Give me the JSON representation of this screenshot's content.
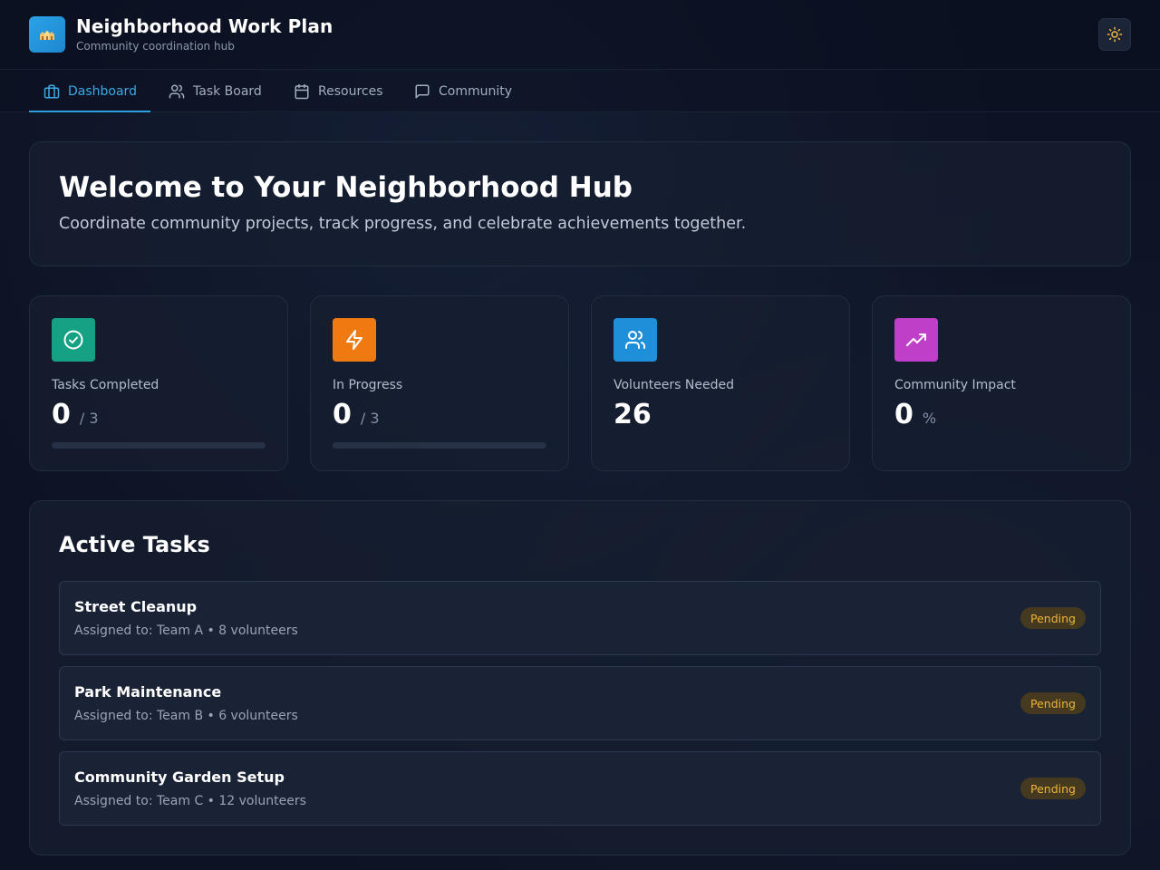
{
  "header": {
    "title": "Neighborhood Work Plan",
    "subtitle": "Community coordination hub",
    "logo_icon": "houses-icon",
    "theme_toggle_icon": "sun-icon"
  },
  "nav": {
    "tabs": [
      {
        "label": "Dashboard",
        "icon": "briefcase-icon",
        "active": true
      },
      {
        "label": "Task Board",
        "icon": "users-icon",
        "active": false
      },
      {
        "label": "Resources",
        "icon": "calendar-icon",
        "active": false
      },
      {
        "label": "Community",
        "icon": "chat-icon",
        "active": false
      }
    ]
  },
  "welcome": {
    "title": "Welcome to Your Neighborhood Hub",
    "subtitle": "Coordinate community projects, track progress, and celebrate achievements together."
  },
  "stats": [
    {
      "label": "Tasks Completed",
      "value": "0",
      "suffix": "/ 3",
      "icon": "check-circle-icon",
      "color": "#14a184",
      "progress": 0
    },
    {
      "label": "In Progress",
      "value": "0",
      "suffix": "/ 3",
      "icon": "lightning-icon",
      "color": "#f07a12",
      "progress": 0
    },
    {
      "label": "Volunteers Needed",
      "value": "26",
      "suffix": "",
      "icon": "users-icon",
      "color": "#1e8fd8"
    },
    {
      "label": "Community Impact",
      "value": "0",
      "suffix": "%",
      "icon": "trending-up-icon",
      "color": "#c03fc8"
    }
  ],
  "tasks": {
    "title": "Active Tasks",
    "items": [
      {
        "name": "Street Cleanup",
        "meta": "Assigned to: Team A • 8 volunteers",
        "status": "Pending"
      },
      {
        "name": "Park Maintenance",
        "meta": "Assigned to: Team B • 6 volunteers",
        "status": "Pending"
      },
      {
        "name": "Community Garden Setup",
        "meta": "Assigned to: Team C • 12 volunteers",
        "status": "Pending"
      }
    ]
  },
  "colors": {
    "accent": "#2f9fe0",
    "pending_badge_bg": "#45391f",
    "pending_badge_text": "#f0b43a"
  }
}
